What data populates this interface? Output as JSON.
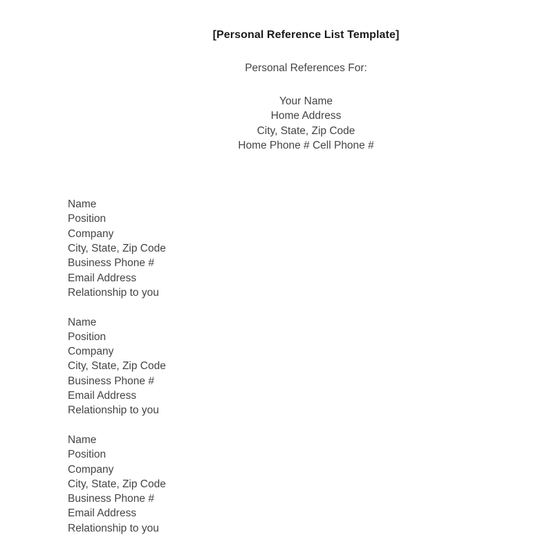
{
  "document": {
    "title": "[Personal Reference List Template]",
    "subtitle": "Personal References For:",
    "header_address": [
      "Your Name",
      "Home Address",
      "City, State, Zip Code",
      "Home Phone # Cell Phone #"
    ],
    "references": [
      {
        "lines": [
          "Name",
          "Position",
          "Company",
          "City, State, Zip Code",
          "Business Phone #",
          "Email Address",
          "Relationship to you"
        ]
      },
      {
        "lines": [
          "Name",
          "Position",
          "Company",
          "City, State, Zip Code",
          "Business Phone #",
          "Email Address",
          "Relationship to you"
        ]
      },
      {
        "lines": [
          "Name",
          "Position",
          "Company",
          "City, State, Zip Code",
          "Business Phone #",
          "Email Address",
          "Relationship to you"
        ]
      }
    ]
  },
  "colors": {
    "page_background": "#ffffff",
    "title_text": "#1a1a1a",
    "body_text": "#444444"
  }
}
